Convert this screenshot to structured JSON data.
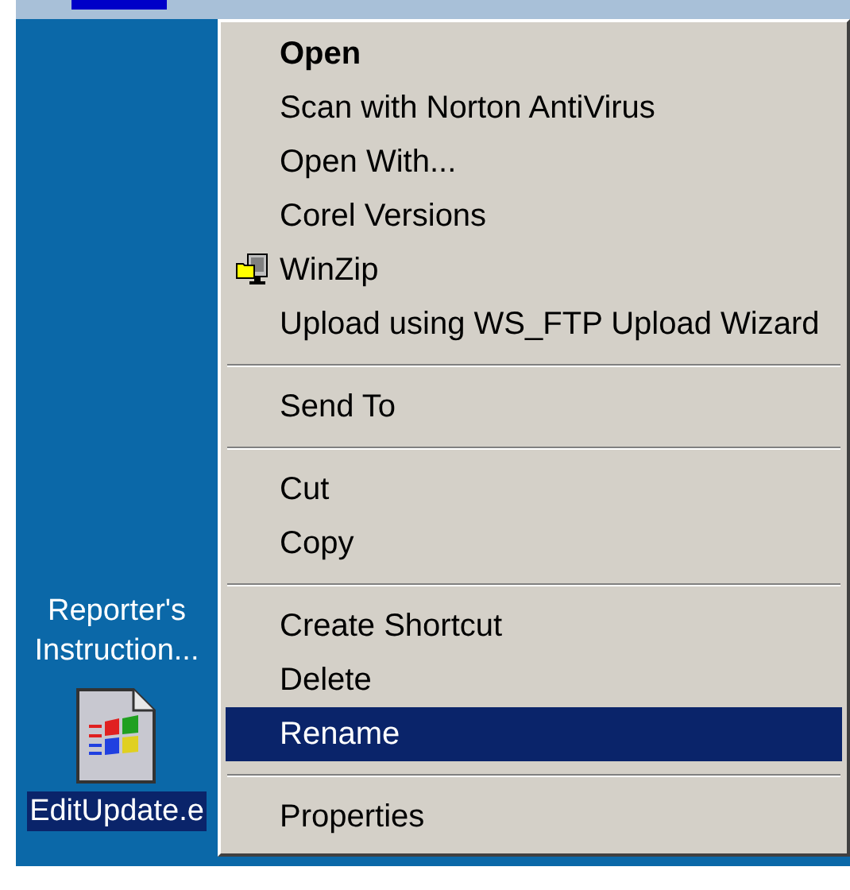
{
  "desktop_icons": [
    {
      "label": "Reporter's Instruction...",
      "kind": "label_only",
      "selected": false
    },
    {
      "label": "EditUpdate.e",
      "kind": "setup_file",
      "selected": true
    }
  ],
  "context_menu": {
    "items": [
      {
        "kind": "item",
        "label": "Open",
        "default": true,
        "selected": false
      },
      {
        "kind": "item",
        "label": "Scan with Norton AntiVirus",
        "default": false,
        "selected": false
      },
      {
        "kind": "item",
        "label": "Open With...",
        "default": false,
        "selected": false
      },
      {
        "kind": "item",
        "label": "Corel Versions",
        "default": false,
        "selected": false
      },
      {
        "kind": "icon_item",
        "label": "WinZip",
        "default": false,
        "selected": false
      },
      {
        "kind": "item",
        "label": "Upload using WS_FTP Upload Wizard",
        "default": false,
        "selected": false
      },
      {
        "kind": "separator"
      },
      {
        "kind": "item",
        "label": "Send To",
        "default": false,
        "selected": false
      },
      {
        "kind": "separator"
      },
      {
        "kind": "item",
        "label": "Cut",
        "default": false,
        "selected": false
      },
      {
        "kind": "item",
        "label": "Copy",
        "default": false,
        "selected": false
      },
      {
        "kind": "separator"
      },
      {
        "kind": "item",
        "label": "Create Shortcut",
        "default": false,
        "selected": false
      },
      {
        "kind": "item",
        "label": "Delete",
        "default": false,
        "selected": false
      },
      {
        "kind": "item",
        "label": "Rename",
        "default": false,
        "selected": true
      },
      {
        "kind": "separator"
      },
      {
        "kind": "item",
        "label": "Properties",
        "default": false,
        "selected": false
      }
    ]
  }
}
